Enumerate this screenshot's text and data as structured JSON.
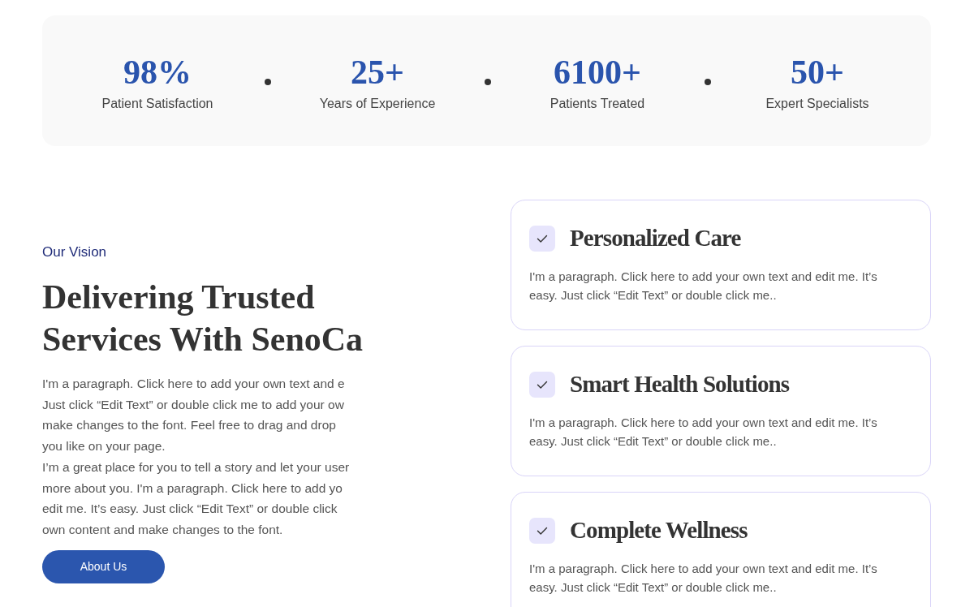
{
  "stats": [
    {
      "value": "98%",
      "label": "Patient Satisfaction"
    },
    {
      "value": "25+",
      "label": "Years of Experience"
    },
    {
      "value": "6100+",
      "label": "Patients Treated"
    },
    {
      "value": "50+",
      "label": "Expert Specialists"
    }
  ],
  "vision": {
    "eyebrow": "Our Vision",
    "title_lines": [
      "Delivering Trusted",
      "Services With SenoCa"
    ],
    "body_lines": [
      "I'm a paragraph. Click here to add your own text and e",
      "Just click “Edit Text” or double click me to add your ow",
      "make changes to the font. Feel free to drag and drop",
      "you like on your page.",
      "I’m a great place for you to tell a story and let your user",
      "more about you. I'm a paragraph. Click here to add yo",
      "edit me. It’s easy. Just click “Edit Text” or double click",
      "own content and make changes to the font."
    ],
    "button": "About Us"
  },
  "features": [
    {
      "title": "Personalized Care",
      "text": "I'm a paragraph. Click here to add your own text and edit me. It’s easy. Just click “Edit Text” or double click me.."
    },
    {
      "title": "Smart Health Solutions",
      "text": "I'm a paragraph. Click here to add your own text and edit me. It’s easy. Just click “Edit Text” or double click me.."
    },
    {
      "title": "Complete Wellness",
      "text": "I'm a paragraph. Click here to add your own text and edit me. It’s easy. Just click “Edit Text” or double click me.."
    }
  ]
}
